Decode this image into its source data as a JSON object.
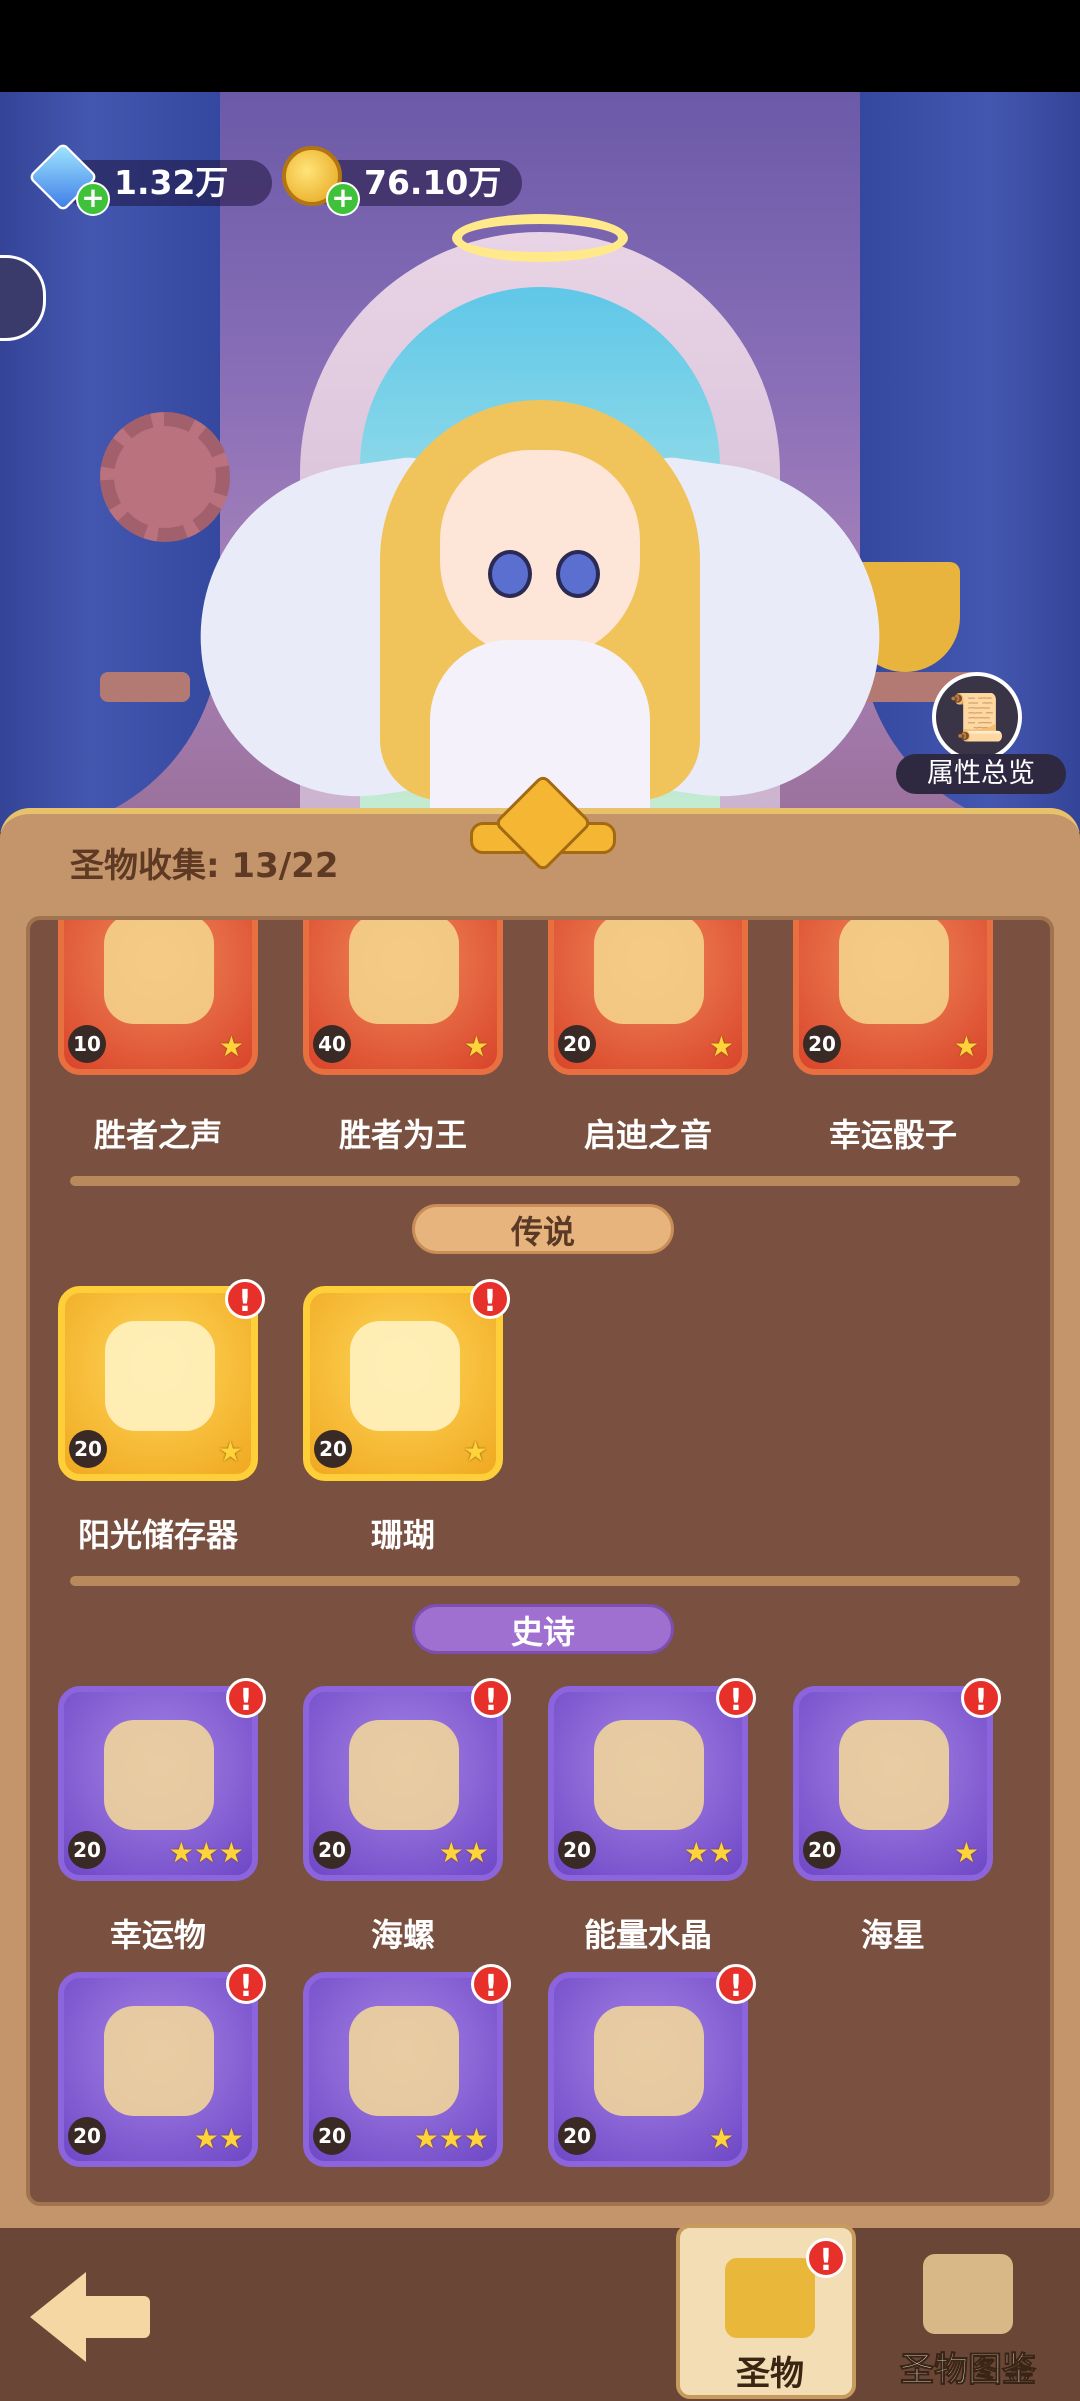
{
  "currency": {
    "gems": "1.32万",
    "coins": "76.10万"
  },
  "attributes_button": {
    "label": "属性总览"
  },
  "collection": {
    "label": "圣物收集: 13/22"
  },
  "sections": {
    "legendary": "传说",
    "epic": "史诗"
  },
  "top_row": [
    {
      "name": "胜者之声",
      "level": "10",
      "stars": "★"
    },
    {
      "name": "胜者为王",
      "level": "40",
      "stars": "★"
    },
    {
      "name": "启迪之音",
      "level": "20",
      "stars": "★"
    },
    {
      "name": "幸运骰子",
      "level": "20",
      "stars": "★"
    }
  ],
  "legendary_items": [
    {
      "name": "阳光储存器",
      "level": "20",
      "stars": "★",
      "alert": "!"
    },
    {
      "name": "珊瑚",
      "level": "20",
      "stars": "★",
      "alert": "!"
    }
  ],
  "epic_items": [
    {
      "name": "幸运物",
      "level": "20",
      "stars": "★★★",
      "alert": "!"
    },
    {
      "name": "海螺",
      "level": "20",
      "stars": "★★",
      "alert": "!"
    },
    {
      "name": "能量水晶",
      "level": "20",
      "stars": "★★",
      "alert": "!"
    },
    {
      "name": "海星",
      "level": "20",
      "stars": "★",
      "alert": "!"
    },
    {
      "name": "",
      "level": "20",
      "stars": "★★",
      "alert": "!"
    },
    {
      "name": "",
      "level": "20",
      "stars": "★★★",
      "alert": "!"
    },
    {
      "name": "",
      "level": "20",
      "stars": "★",
      "alert": "!"
    }
  ],
  "bottom_nav": {
    "relics": "圣物",
    "relic_codex": "圣物图鉴",
    "relics_alert": "!"
  }
}
